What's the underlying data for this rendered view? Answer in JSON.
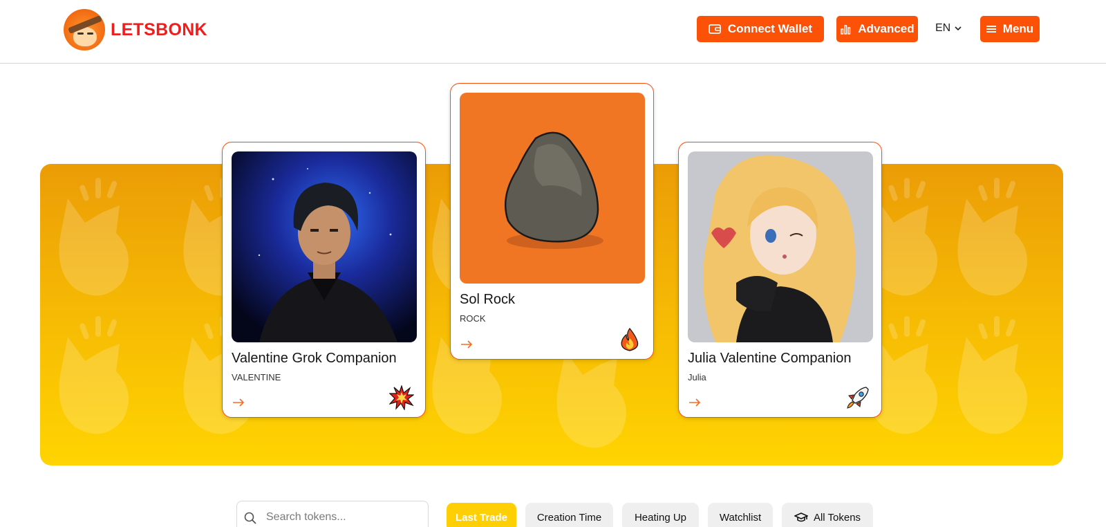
{
  "header": {
    "brand": "LETSBONK",
    "connect_wallet": "Connect Wallet",
    "advanced": "Advanced",
    "language": "EN",
    "menu": "Menu"
  },
  "featured": [
    {
      "name": "Valentine Grok Companion",
      "symbol": "VALENTINE",
      "badge_icon": "explosion-icon"
    },
    {
      "name": "Sol Rock",
      "symbol": "ROCK",
      "badge_icon": "fire-icon"
    },
    {
      "name": "Julia Valentine Companion",
      "symbol": "Julia",
      "badge_icon": "rocket-icon"
    }
  ],
  "search": {
    "placeholder": "Search tokens..."
  },
  "tabs": [
    {
      "label": "Last Trade",
      "active": true
    },
    {
      "label": "Creation Time",
      "active": false
    },
    {
      "label": "Heating Up",
      "active": false
    },
    {
      "label": "Watchlist",
      "active": false
    },
    {
      "label": "All Tokens",
      "active": false,
      "icon": "graduation-cap-icon"
    }
  ],
  "colors": {
    "accent": "#fc5208",
    "brand_text": "#f01d1d",
    "banner_top": "#eb9c06",
    "banner_bottom": "#ffd401",
    "active_tab": "#ffcf06"
  }
}
